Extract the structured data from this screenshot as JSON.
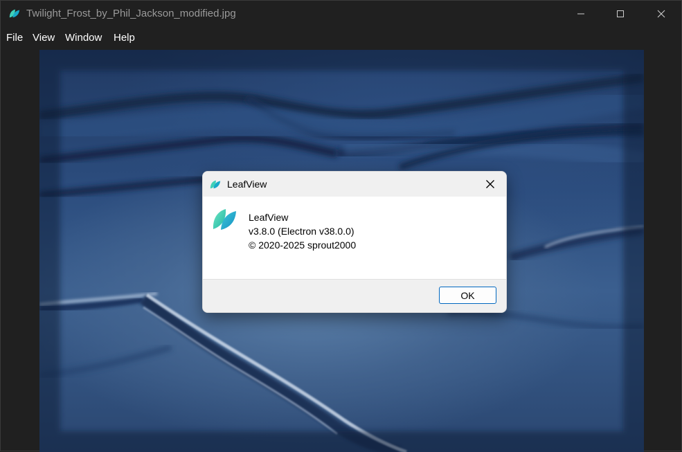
{
  "window": {
    "title": "Twilight_Frost_by_Phil_Jackson_modified.jpg",
    "app_icon": "leaf-icon"
  },
  "menu": {
    "items": [
      {
        "label": "File"
      },
      {
        "label": "View"
      },
      {
        "label": "Window"
      },
      {
        "label": "Help"
      }
    ]
  },
  "caption_buttons": {
    "minimize_icon": "minimize-icon",
    "maximize_icon": "maximize-icon",
    "close_icon": "close-icon"
  },
  "dialog": {
    "title": "LeafView",
    "app_name": "LeafView",
    "version": "v3.8.0 (Electron v38.0.0)",
    "copyright": "© 2020-2025 sprout2000",
    "ok_label": "OK"
  },
  "colors": {
    "window_bg": "#202020",
    "accent": "#0067c0",
    "leaf_light": "#5fe0c8",
    "leaf_dark": "#1aa6c8"
  }
}
